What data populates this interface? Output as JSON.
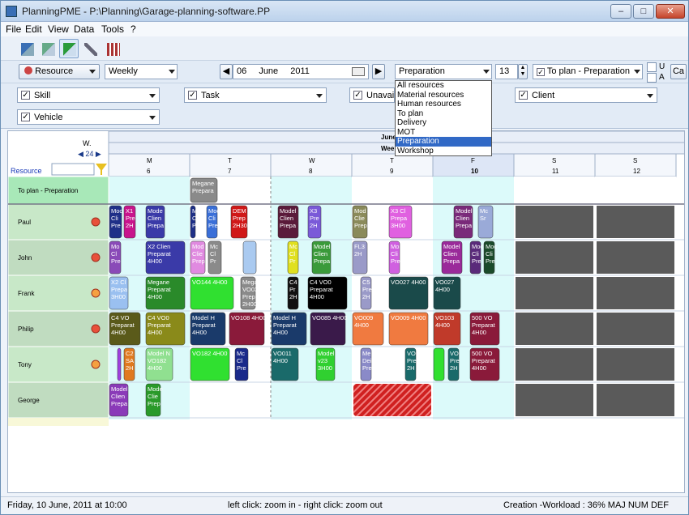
{
  "window": {
    "title": "PlanningPME - P:\\Planning\\Garage-planning-software.PP"
  },
  "menubar": {
    "items": [
      "File",
      "Edit",
      "View",
      "Data",
      "Tools",
      "?"
    ]
  },
  "toolbar2": {
    "resource_label": "Resource",
    "view_mode": "Weekly",
    "day": "06",
    "month": "June",
    "year": "2011",
    "filter_value": "Preparation",
    "count": "13",
    "to_plan_label": "To plan - Preparation",
    "u_label": "U",
    "a_label": "A",
    "ca_label": "Ca"
  },
  "dropdown": {
    "options": [
      "All resources",
      "Material resources",
      "Human resources",
      "To plan",
      "Delivery",
      "MOT",
      "Preparation",
      "Workshop"
    ],
    "selected_index": 6
  },
  "filters": {
    "skill": "Skill",
    "task": "Task",
    "unavailability": "Unavaila",
    "client": "Client",
    "vehicle": "Vehicle"
  },
  "grid": {
    "week_prefix": "W.",
    "week_number": "24",
    "resource_header": "Resource",
    "month_header": "June",
    "week_header": "Wee",
    "days": [
      {
        "letter": "M",
        "num": "6"
      },
      {
        "letter": "T",
        "num": "7"
      },
      {
        "letter": "W",
        "num": "8"
      },
      {
        "letter": "T",
        "num": "9"
      },
      {
        "letter": "F",
        "num": "10"
      },
      {
        "letter": "S",
        "num": "11"
      },
      {
        "letter": "S",
        "num": "12"
      }
    ],
    "rows": [
      {
        "name": "To plan - Preparation",
        "dot": ""
      },
      {
        "name": "Paul",
        "dot": "#e8503a"
      },
      {
        "name": "John",
        "dot": "#e8503a"
      },
      {
        "name": "Frank",
        "dot": "#f5a040"
      },
      {
        "name": "Philip",
        "dot": "#e8503a"
      },
      {
        "name": "Tony",
        "dot": "#f5a040"
      },
      {
        "name": "George",
        "dot": ""
      }
    ]
  },
  "tasks": [
    {
      "row": 0,
      "day": 1,
      "o": 0.0,
      "w": 0.35,
      "color": "#8a8a8a",
      "text": "Megane Preparat"
    },
    {
      "row": 1,
      "day": 0,
      "o": 0.0,
      "w": 0.17,
      "color": "#1e2f88",
      "text": "Moc Clie Prep"
    },
    {
      "row": 1,
      "day": 0,
      "o": 0.18,
      "w": 0.16,
      "color": "#c8148c",
      "text": "X1 Pre 2H"
    },
    {
      "row": 1,
      "day": 0,
      "o": 0.45,
      "w": 0.25,
      "color": "#3a3aa8",
      "text": "Mode Client Prepa"
    },
    {
      "row": 1,
      "day": 1,
      "o": 0.0,
      "w": 0.08,
      "color": "#1e2f88",
      "text": "M C P"
    },
    {
      "row": 1,
      "day": 1,
      "o": 0.2,
      "w": 0.15,
      "color": "#3a6fd8",
      "text": "Moc Clie Prep"
    },
    {
      "row": 1,
      "day": 1,
      "o": 0.5,
      "w": 0.22,
      "color": "#d01818",
      "text": "DEM Prepa 2H30"
    },
    {
      "row": 1,
      "day": 2,
      "o": 0.08,
      "w": 0.27,
      "color": "#5a1a3a",
      "text": "Model Client Prepa"
    },
    {
      "row": 1,
      "day": 2,
      "o": 0.45,
      "w": 0.18,
      "color": "#7a5ad8",
      "text": "X3 Pre 2H"
    },
    {
      "row": 1,
      "day": 3,
      "o": 0.0,
      "w": 0.2,
      "color": "#8a8a5a",
      "text": "Mod Clier Prep"
    },
    {
      "row": 1,
      "day": 3,
      "o": 0.45,
      "w": 0.3,
      "color": "#e060e0",
      "text": "X3 Cl Prepa 3H00"
    },
    {
      "row": 1,
      "day": 4,
      "o": 0.25,
      "w": 0.25,
      "color": "#7a2a7a",
      "text": "Model Client Prepa"
    },
    {
      "row": 1,
      "day": 4,
      "o": 0.55,
      "w": 0.2,
      "color": "#9aaad8",
      "text": "Mc Sr"
    },
    {
      "row": 2,
      "day": 0,
      "o": 0.0,
      "w": 0.16,
      "color": "#8a4ab8",
      "text": "Mo Cl Pre"
    },
    {
      "row": 2,
      "day": 0,
      "o": 0.45,
      "w": 0.5,
      "color": "#3a3aa8",
      "text": "X2 Clien Preparat 4H00"
    },
    {
      "row": 2,
      "day": 1,
      "o": 0.0,
      "w": 0.2,
      "color": "#e08ae0",
      "text": "Mod Clier Prep"
    },
    {
      "row": 2,
      "day": 1,
      "o": 0.22,
      "w": 0.18,
      "color": "#8a8a8a",
      "text": "Mc Cl Pr"
    },
    {
      "row": 2,
      "day": 1,
      "o": 0.65,
      "w": 0.18,
      "color": "#aacaf0",
      "text": ""
    },
    {
      "row": 2,
      "day": 2,
      "o": 0.2,
      "w": 0.15,
      "color": "#e0e020",
      "text": "Mc Cl Pr"
    },
    {
      "row": 2,
      "day": 2,
      "o": 0.5,
      "w": 0.25,
      "color": "#3a9a3a",
      "text": "Model Client Prepa"
    },
    {
      "row": 2,
      "day": 3,
      "o": 0.0,
      "w": 0.2,
      "color": "#9a9ac8",
      "text": "FL3 2H"
    },
    {
      "row": 2,
      "day": 3,
      "o": 0.45,
      "w": 0.15,
      "color": "#d060e0",
      "text": "Mo Cli Pre"
    },
    {
      "row": 2,
      "day": 4,
      "o": 0.1,
      "w": 0.27,
      "color": "#9a2a9a",
      "text": "Model Client Prepa"
    },
    {
      "row": 2,
      "day": 4,
      "o": 0.45,
      "w": 0.15,
      "color": "#5a2a7a",
      "text": "Moc Clie Pre"
    },
    {
      "row": 2,
      "day": 4,
      "o": 0.62,
      "w": 0.15,
      "color": "#1a4a2a",
      "text": "Moc Clie Pre"
    },
    {
      "row": 3,
      "day": 0,
      "o": 0.0,
      "w": 0.25,
      "color": "#9ac0f0",
      "text": "X2 Cl Prepa 3H00"
    },
    {
      "row": 3,
      "day": 0,
      "o": 0.45,
      "w": 0.5,
      "color": "#2a8a2a",
      "text": "Megane Preparat 4H00"
    },
    {
      "row": 3,
      "day": 1,
      "o": 0.0,
      "w": 0.55,
      "color": "#30e030",
      "text": "VO144 4H00"
    },
    {
      "row": 3,
      "day": 1,
      "o": 0.62,
      "w": 0.2,
      "color": "#8a8a8a",
      "text": "Megan VO03 Prepa 2H00"
    },
    {
      "row": 3,
      "day": 2,
      "o": 0.2,
      "w": 0.15,
      "color": "#111",
      "text": "C4 Pr 2H"
    },
    {
      "row": 3,
      "day": 2,
      "o": 0.45,
      "w": 0.5,
      "color": "#000",
      "text": "C4 VO0 Preparat 4H00"
    },
    {
      "row": 3,
      "day": 3,
      "o": 0.1,
      "w": 0.15,
      "color": "#9a9ac8",
      "text": "C5 Pre 2H"
    },
    {
      "row": 3,
      "day": 3,
      "o": 0.45,
      "w": 0.5,
      "color": "#1a4a4a",
      "text": "VO027 4H00"
    },
    {
      "row": 3,
      "day": 4,
      "o": 0.0,
      "w": 0.35,
      "color": "#1a4a4a",
      "text": "VO027 4H00"
    },
    {
      "row": 4,
      "day": 0,
      "o": 0.0,
      "w": 0.4,
      "color": "#5a5a1a",
      "text": "C4 VO Preparat 4H00"
    },
    {
      "row": 4,
      "day": 0,
      "o": 0.45,
      "w": 0.5,
      "color": "#8a8a1a",
      "text": "C4 VO0 Preparat 4H00"
    },
    {
      "row": 4,
      "day": 1,
      "o": 0.0,
      "w": 0.45,
      "color": "#1a3a6a",
      "text": "Model H Preparat 4H00"
    },
    {
      "row": 4,
      "day": 1,
      "o": 0.48,
      "w": 0.45,
      "color": "#8a1a3a",
      "text": "VO108 4H00"
    },
    {
      "row": 4,
      "day": 2,
      "o": 0.0,
      "w": 0.45,
      "color": "#1a3a6a",
      "text": "Model H Preparat 4H00"
    },
    {
      "row": 4,
      "day": 2,
      "o": 0.48,
      "w": 0.45,
      "color": "#3a1a4a",
      "text": "VO085 4H00"
    },
    {
      "row": 4,
      "day": 3,
      "o": 0.0,
      "w": 0.4,
      "color": "#f07a40",
      "text": "VO009 4H00"
    },
    {
      "row": 4,
      "day": 3,
      "o": 0.45,
      "w": 0.5,
      "color": "#f07a40",
      "text": "VO009 4H00"
    },
    {
      "row": 4,
      "day": 4,
      "o": 0.0,
      "w": 0.35,
      "color": "#c03a2a",
      "text": "VO103 4H00"
    },
    {
      "row": 4,
      "day": 4,
      "o": 0.45,
      "w": 0.38,
      "color": "#8a1a3a",
      "text": "500 VO Preparat 4H00"
    },
    {
      "row": 5,
      "day": 0,
      "o": 0.1,
      "w": 0.06,
      "color": "#a040e0",
      "text": ""
    },
    {
      "row": 5,
      "day": 0,
      "o": 0.18,
      "w": 0.15,
      "color": "#e07a20",
      "text": "C2 SA 2H"
    },
    {
      "row": 5,
      "day": 0,
      "o": 0.45,
      "w": 0.35,
      "color": "#90e090",
      "text": "Model N VO182 4H00"
    },
    {
      "row": 5,
      "day": 1,
      "o": 0.0,
      "w": 0.5,
      "color": "#30e030",
      "text": "VO182 4H00"
    },
    {
      "row": 5,
      "day": 1,
      "o": 0.55,
      "w": 0.18,
      "color": "#1a2a8a",
      "text": "Mc Cl Pre"
    },
    {
      "row": 5,
      "day": 2,
      "o": 0.0,
      "w": 0.35,
      "color": "#1a6a6a",
      "text": "VO011 4H00"
    },
    {
      "row": 5,
      "day": 2,
      "o": 0.55,
      "w": 0.25,
      "color": "#30d030",
      "text": "Model v23 3H00"
    },
    {
      "row": 5,
      "day": 3,
      "o": 0.1,
      "w": 0.15,
      "color": "#8a8ac8",
      "text": "Me Dei Pre"
    },
    {
      "row": 5,
      "day": 3,
      "o": 0.65,
      "w": 0.15,
      "color": "#1a6a6a",
      "text": "VO Pre 2H"
    },
    {
      "row": 5,
      "day": 4,
      "o": 0.0,
      "w": 0.15,
      "color": "#30e030",
      "text": ""
    },
    {
      "row": 5,
      "day": 4,
      "o": 0.18,
      "w": 0.15,
      "color": "#1a6a6a",
      "text": "VO Pre 2H"
    },
    {
      "row": 5,
      "day": 4,
      "o": 0.45,
      "w": 0.38,
      "color": "#8a1a3a",
      "text": "500 VO Preparat 4H00"
    },
    {
      "row": 6,
      "day": 0,
      "o": 0.0,
      "w": 0.25,
      "color": "#8a3ab8",
      "text": "Model Client Prepa"
    },
    {
      "row": 6,
      "day": 0,
      "o": 0.45,
      "w": 0.2,
      "color": "#2a9a2a",
      "text": "Mode Client Prepa"
    }
  ],
  "status": {
    "datetime": "Friday, 10 June, 2011 at 10:00",
    "hint": "left click: zoom in - right click: zoom out",
    "info": "Creation -Workload : 36%  MAJ  NUM  DEF"
  }
}
